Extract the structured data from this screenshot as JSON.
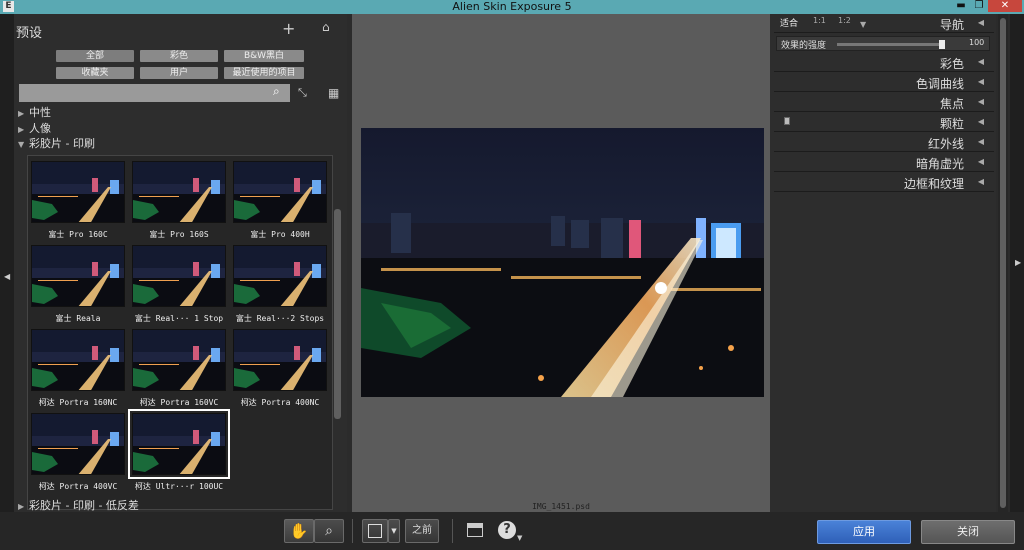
{
  "window": {
    "title": "Alien Skin Exposure 5",
    "app_icon": "E",
    "minimize_icon": "minimize-icon",
    "maximize_icon": "restore-icon",
    "close_icon": "close-icon",
    "close_color": "#c7473d",
    "titlebar_color": "#5aa9b3"
  },
  "left_panel": {
    "title": "预设",
    "filters": [
      {
        "label": "全部"
      },
      {
        "label": "彩色"
      },
      {
        "label": "B&W黑白"
      },
      {
        "label": "收藏夹"
      },
      {
        "label": "用户"
      },
      {
        "label": "最近使用的项目"
      }
    ],
    "search": {
      "placeholder": "",
      "value": ""
    },
    "tree": [
      {
        "label": "中性"
      },
      {
        "label": "人像"
      },
      {
        "label": "彩胶片 - 印刷"
      }
    ],
    "presets": [
      {
        "label": "富士 Pro 160C"
      },
      {
        "label": "富士 Pro 160S"
      },
      {
        "label": "富士 Pro 400H"
      },
      {
        "label": "富士 Reala"
      },
      {
        "label": "富士 Real··· 1 Stop"
      },
      {
        "label": "富士 Real···2 Stops"
      },
      {
        "label": "柯达 Portra 160NC"
      },
      {
        "label": "柯达 Portra 160VC"
      },
      {
        "label": "柯达 Portra 400NC"
      },
      {
        "label": "柯达 Portra 400VC"
      },
      {
        "label": "柯达 Ultr···r 100UC"
      }
    ],
    "selected_preset_index": 10,
    "bottom_tree": {
      "label": "彩胶片 - 印刷 - 低反差"
    }
  },
  "center": {
    "file_name": "IMG_1451.psd"
  },
  "right_panel": {
    "zoom": {
      "fit": "适合",
      "one": "1:1",
      "half": "1:2"
    },
    "nav_label": "导航",
    "strength": {
      "label": "效果的强度",
      "value": "100",
      "level": 1.0
    },
    "sections": [
      {
        "label": "彩色"
      },
      {
        "label": "色调曲线"
      },
      {
        "label": "焦点"
      },
      {
        "label": "颗粒"
      },
      {
        "label": "红外线"
      },
      {
        "label": "暗角虚光"
      },
      {
        "label": "边框和纹理"
      }
    ]
  },
  "toolbar": {
    "hand_icon": "hand-icon",
    "zoom_icon": "zoom-icon",
    "compare_label": "之前",
    "help_icon": "help-icon",
    "apply_label": "应用",
    "close_label": "关闭",
    "apply_color": "#3a70c8"
  }
}
